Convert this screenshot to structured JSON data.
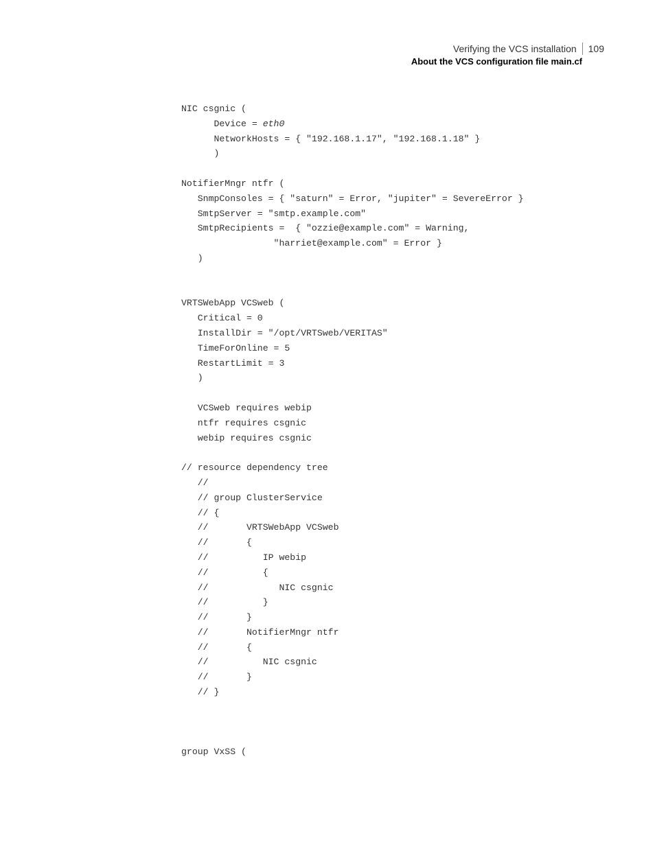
{
  "header": {
    "chapter": "Verifying the VCS installation",
    "section": "About the VCS configuration file main.cf",
    "page": "109"
  },
  "code": {
    "l01": "NIC csgnic (",
    "l02": "      Device = ",
    "l02i": "eth0",
    "l03": "      NetworkHosts = { \"192.168.1.17\", \"192.168.1.18\" }",
    "l04": "      )",
    "l05": "",
    "l06": "NotifierMngr ntfr (",
    "l07": "   SnmpConsoles = { \"saturn\" = Error, \"jupiter\" = SevereError }",
    "l08": "   SmtpServer = \"smtp.example.com\"",
    "l09": "   SmtpRecipients =  { \"ozzie@example.com\" = Warning,",
    "l10": "                 \"harriet@example.com\" = Error }",
    "l11": "   )",
    "l12": "",
    "l13": "",
    "l14": "VRTSWebApp VCSweb (",
    "l15": "   Critical = 0",
    "l16": "   InstallDir = \"/opt/VRTSweb/VERITAS\"",
    "l17": "   TimeForOnline = 5",
    "l18": "   RestartLimit = 3",
    "l19": "   )",
    "l20": "",
    "l21": "   VCSweb requires webip",
    "l22": "   ntfr requires csgnic",
    "l23": "   webip requires csgnic",
    "l24": "",
    "l25": "// resource dependency tree",
    "l26": "   //",
    "l27": "   // group ClusterService",
    "l28": "   // {",
    "l29": "   //       VRTSWebApp VCSweb",
    "l30": "   //       {",
    "l31": "   //          IP webip",
    "l32": "   //          {",
    "l33": "   //             NIC csgnic",
    "l34": "   //          }",
    "l35": "   //       }",
    "l36": "   //       NotifierMngr ntfr",
    "l37": "   //       {",
    "l38": "   //          NIC csgnic",
    "l39": "   //       }",
    "l40": "   // }",
    "l41": "",
    "l42": "",
    "l43": "",
    "l44": "group VxSS ("
  }
}
